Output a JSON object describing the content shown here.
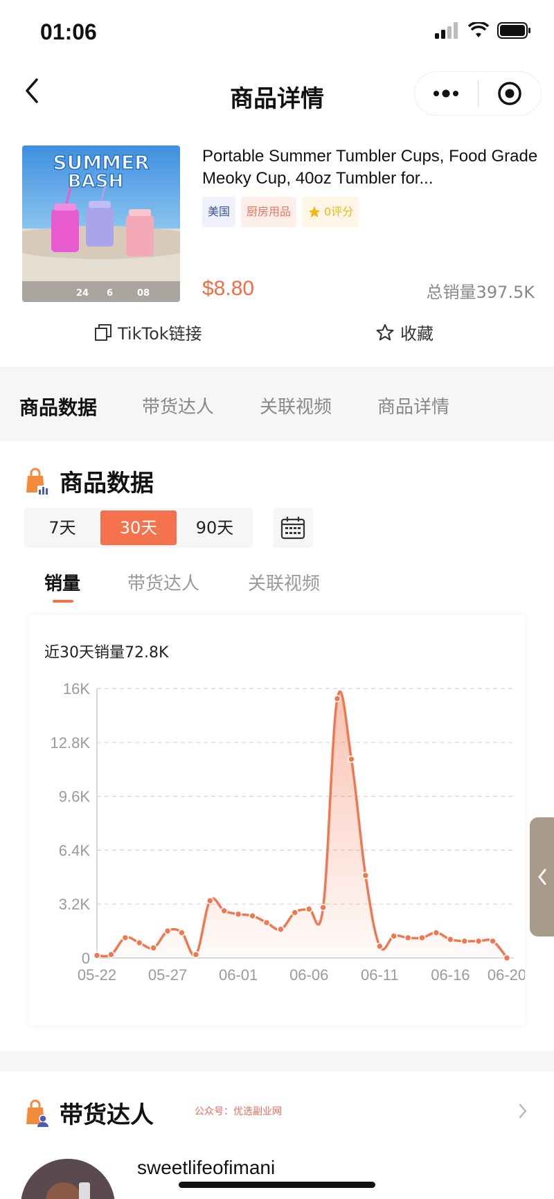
{
  "status": {
    "time": "01:06"
  },
  "nav": {
    "title": "商品详情"
  },
  "product": {
    "title": "Portable Summer Tumbler Cups, Food Grade Meoky Cup, 40oz Tumbler for...",
    "image_text": {
      "headline_1": "SUMMER",
      "headline_2": "BASH",
      "stat_1": "24",
      "stat_2": "6",
      "stat_3": "08"
    },
    "tags": {
      "country": "美国",
      "category": "厨房用品",
      "rating": "0评分"
    },
    "price": "$8.80",
    "total_sales": "总销量397.5K"
  },
  "actions": {
    "tiktok_link": "TikTok链接",
    "favorite": "收藏"
  },
  "main_tabs": [
    "商品数据",
    "带货达人",
    "关联视频",
    "商品详情"
  ],
  "data_section": {
    "title": "商品数据",
    "ranges": [
      "7天",
      "30天",
      "90天"
    ],
    "active_range": "30天",
    "sub_tabs": [
      "销量",
      "带货达人",
      "关联视频"
    ]
  },
  "chart_data": {
    "type": "area",
    "caption": "近30天销量72.8K",
    "x_ticks": [
      "05-22",
      "05-27",
      "06-01",
      "06-06",
      "06-11",
      "06-16",
      "06-20"
    ],
    "y_ticks": [
      "0",
      "3.2K",
      "6.4K",
      "9.6K",
      "12.8K",
      "16K"
    ],
    "ylim": [
      0,
      16000
    ],
    "x": [
      "05-22",
      "05-23",
      "05-24",
      "05-25",
      "05-26",
      "05-27",
      "05-28",
      "05-29",
      "05-30",
      "05-31",
      "06-01",
      "06-02",
      "06-03",
      "06-04",
      "06-05",
      "06-06",
      "06-07",
      "06-08",
      "06-09",
      "06-10",
      "06-11",
      "06-12",
      "06-13",
      "06-14",
      "06-15",
      "06-16",
      "06-17",
      "06-18",
      "06-19",
      "06-20"
    ],
    "values": [
      150,
      200,
      1200,
      900,
      600,
      1600,
      1500,
      200,
      3400,
      2800,
      2600,
      2500,
      2100,
      1700,
      2700,
      2900,
      3000,
      15400,
      11800,
      4900,
      700,
      1300,
      1200,
      1200,
      1500,
      1100,
      1000,
      1000,
      1000,
      0
    ],
    "grid": true,
    "color": "#f07850"
  },
  "influencer_section": {
    "title": "带货达人",
    "watermark": "公众号：优选副业网",
    "first_name": "sweetlifeofimani"
  }
}
